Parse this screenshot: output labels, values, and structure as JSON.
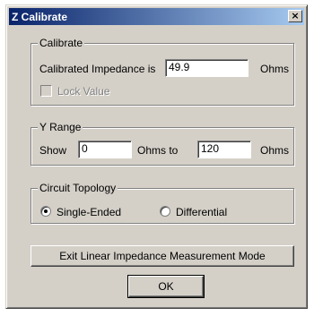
{
  "window": {
    "title": "Z Calibrate",
    "close_glyph": "×"
  },
  "calibrate": {
    "group_label": "Calibrate",
    "impedance_label": "Calibrated Impedance is",
    "impedance_value": "49.9",
    "impedance_unit": "Ohms",
    "lock_label": "Lock Value",
    "lock_checked": false,
    "lock_enabled": false
  },
  "y_range": {
    "group_label": "Y Range",
    "show_label": "Show",
    "min_value": "0",
    "mid_label": "Ohms to",
    "max_value": "120",
    "end_unit": "Ohms"
  },
  "topology": {
    "group_label": "Circuit Topology",
    "options": [
      {
        "label": "Single-Ended",
        "selected": true
      },
      {
        "label": "Differential",
        "selected": false
      }
    ]
  },
  "buttons": {
    "exit_label": "Exit Linear Impedance Measurement Mode",
    "ok_label": "OK"
  }
}
